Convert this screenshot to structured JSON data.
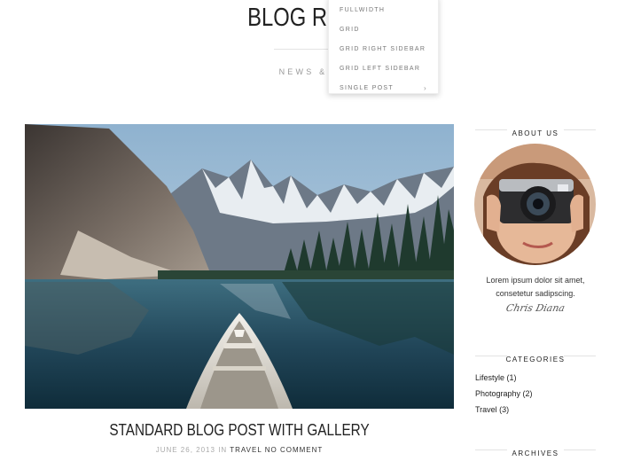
{
  "header": {
    "title": "BLOG RIGHT",
    "subtitle": "NEWS & ID"
  },
  "dropdown": {
    "items": [
      {
        "label": "FULLWIDTH"
      },
      {
        "label": "GRID"
      },
      {
        "label": "GRID RIGHT SIDEBAR"
      },
      {
        "label": "GRID LEFT SIDEBAR"
      },
      {
        "label": "SINGLE POST",
        "chevron": "›"
      }
    ]
  },
  "post": {
    "title": "STANDARD BLOG POST WITH GALLERY",
    "date": "JUNE 26, 2013",
    "in_word": "IN",
    "category": "TRAVEL",
    "comments": "NO COMMENT",
    "image": "mountain-lake-canoe-photo"
  },
  "sidebar": {
    "about": {
      "heading": "ABOUT US",
      "text_line1": "Lorem ipsum dolor sit amet,",
      "text_line2": "consetetur sadipscing.",
      "signature": "Chris Diana",
      "image": "woman-with-camera-photo"
    },
    "categories": {
      "heading": "CATEGORIES",
      "items": [
        {
          "label": "Lifestyle (1)"
        },
        {
          "label": "Photography (2)"
        },
        {
          "label": "Travel (3)"
        }
      ]
    },
    "archives": {
      "heading": "ARCHIVES"
    }
  }
}
